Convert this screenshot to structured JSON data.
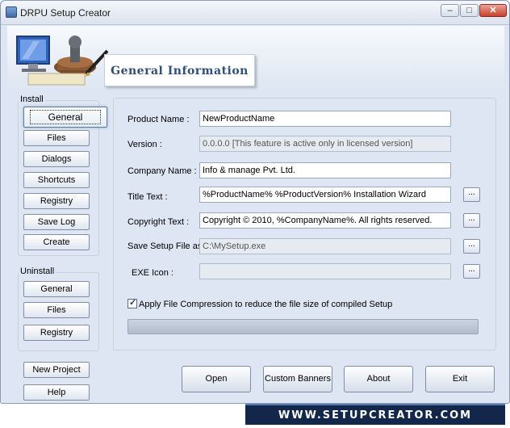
{
  "window": {
    "title": "DRPU Setup Creator"
  },
  "title_buttons": {
    "minimize": "–",
    "maximize": "□",
    "close": "✕"
  },
  "header": {
    "title": "General Information"
  },
  "install": {
    "label": "Install",
    "items": [
      "General",
      "Files",
      "Dialogs",
      "Shortcuts",
      "Registry",
      "Save Log",
      "Create"
    ],
    "active": "General"
  },
  "uninstall": {
    "label": "Uninstall",
    "items": [
      "General",
      "Files",
      "Registry"
    ]
  },
  "side_bottom": {
    "new_project": "New Project",
    "help": "Help"
  },
  "form": {
    "product_name": {
      "label": "Product Name :",
      "value": "NewProductName"
    },
    "version": {
      "label": "Version :",
      "value": "0.0.0.0 [This feature is active only in licensed version]"
    },
    "company_name": {
      "label": "Company Name :",
      "value": "Info & manage Pvt. Ltd."
    },
    "title_text": {
      "label": "Title Text :",
      "value": "%ProductName% %ProductVersion% Installation Wizard"
    },
    "copyright_text": {
      "label": "Copyright Text :",
      "value": "Copyright © 2010, %CompanyName%. All rights reserved."
    },
    "save_setup": {
      "label": "Save Setup File as :",
      "value": "C:\\MySetup.exe"
    },
    "exe_icon": {
      "label": "EXE Icon :",
      "value": ""
    },
    "browse_label": "...",
    "compression": {
      "label": "Apply File Compression to reduce the file size of compiled Setup",
      "checked": true,
      "mark": "✓"
    },
    "progress": 0
  },
  "buttons": {
    "open": "Open",
    "custom_banners": "Custom Banners",
    "about": "About",
    "exit": "Exit"
  },
  "watermark": "WWW.SETUPCREATOR.COM",
  "colors": {
    "background": "#dde6f2",
    "header_text": "#2f4f78",
    "watermark_bg": "#12274a"
  }
}
